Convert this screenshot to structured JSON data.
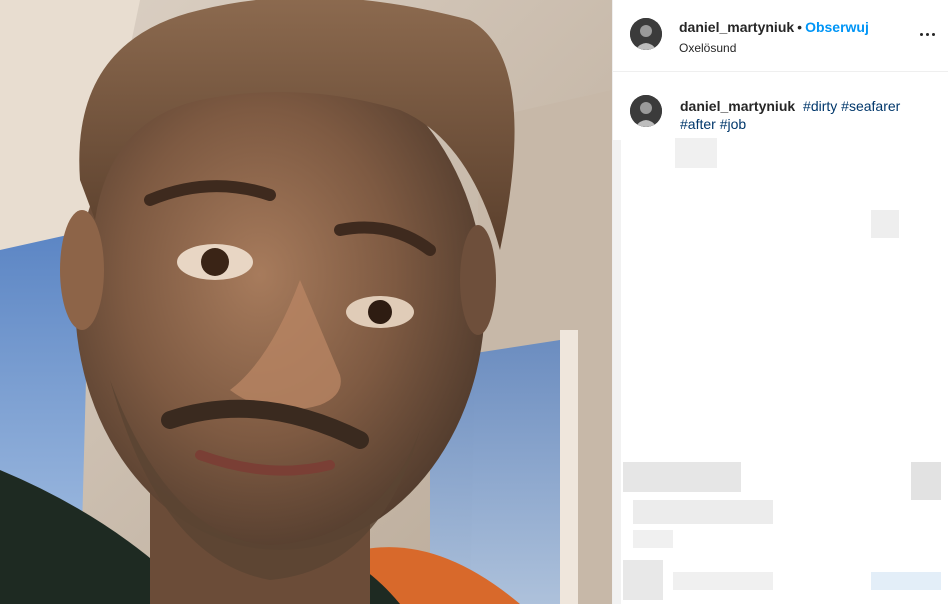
{
  "post": {
    "username": "daniel_martyniuk",
    "separator": "•",
    "follow_label": "Obserwuj",
    "location": "Oxelösund",
    "more_icon": "more-horizontal-icon"
  },
  "caption": {
    "username": "daniel_martyniuk",
    "hashtags": [
      "#dirty",
      "#seafarer",
      "#after",
      "#job"
    ]
  },
  "colors": {
    "follow": "#0095f6",
    "hashtag": "#00376b",
    "text": "#262626",
    "divider": "#efefef"
  }
}
